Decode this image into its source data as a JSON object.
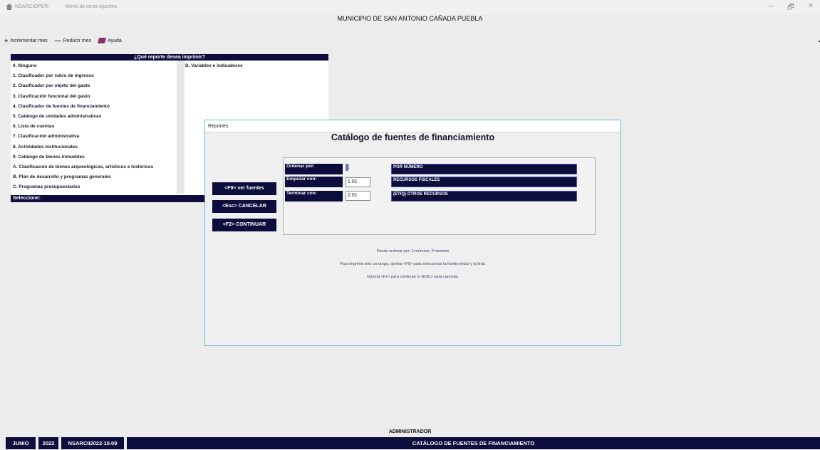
{
  "window": {
    "app_name": "NSARCIOPER:",
    "title": "Menú de otros reportes",
    "minimize": "—",
    "maximize": "🗗",
    "close": "✕"
  },
  "municipality": "MUNICIPIO DE SAN ANTONIO CAÑADA PUEBLA",
  "toolbar": {
    "increment_symbol": "+",
    "increment": "Incrementar mes",
    "reduce_symbol": "—",
    "reduce": "Reducir mes",
    "help": "Ayuda"
  },
  "menu": {
    "header": "¿Qué reporte desea imprimir?",
    "items_left": [
      "0. Ninguno",
      "1. Clasificador por rubro de ingresos",
      "2. Clasificador por objeto del gasto",
      "3. Clasificación funcional del gasto",
      "4. Clasificador de fuentes de financiamiento",
      "5. Catálogo de unidades administrativas",
      "6. Lista de cuentas",
      "7. Clasificación administrativa",
      "8. Actividades institucionales",
      "9. Catálogo de bienes inmuebles",
      "A. Clasificación de bienes arqueológicos, artísticos e históricos",
      "B. Plan de desarrollo y programas generales",
      "C. Programas presupuestarios"
    ],
    "items_right": [
      "D. Variables e indicadores"
    ],
    "footer": "Seleccione:"
  },
  "dialog": {
    "window_title": "Reportes",
    "heading": "Catálogo de fuentes de financiamiento",
    "buttons": {
      "view_sources": "<F9> ver fuentes",
      "cancel": "<Esc> CANCELAR",
      "continue": "<F2> CONTINUAR"
    },
    "form": {
      "order_label": "Ordenar por:",
      "order_value": "1",
      "order_desc": "POR NÚMERO",
      "start_label": "Empezar con:",
      "start_value": "1.01",
      "start_desc": "RECURSOS FISCALES",
      "end_label": "Terminar con:",
      "end_value": "2.01",
      "end_desc": "(ETIQ) OTROS RECURSOS"
    },
    "hints": [
      "Puede ordenar por: 1=número, 2=nombre",
      "Para imprimir sólo un rango, oprima <F9> para seleccionar la fuente inicial y la final.",
      "Oprima <F2> para continuar ó <ESC> para cancelar."
    ]
  },
  "user": "ADMINISTRADOR",
  "status": {
    "month": "JUNIO",
    "year": "2022",
    "code": "NSARCII2022-15.09",
    "current_report": "CATÁLOGO DE FUENTES DE FINANCIAMIENTO"
  },
  "colors": {
    "navy": "#0c0c3d",
    "dialog_border": "#6bb6d6",
    "background": "#ececec"
  }
}
